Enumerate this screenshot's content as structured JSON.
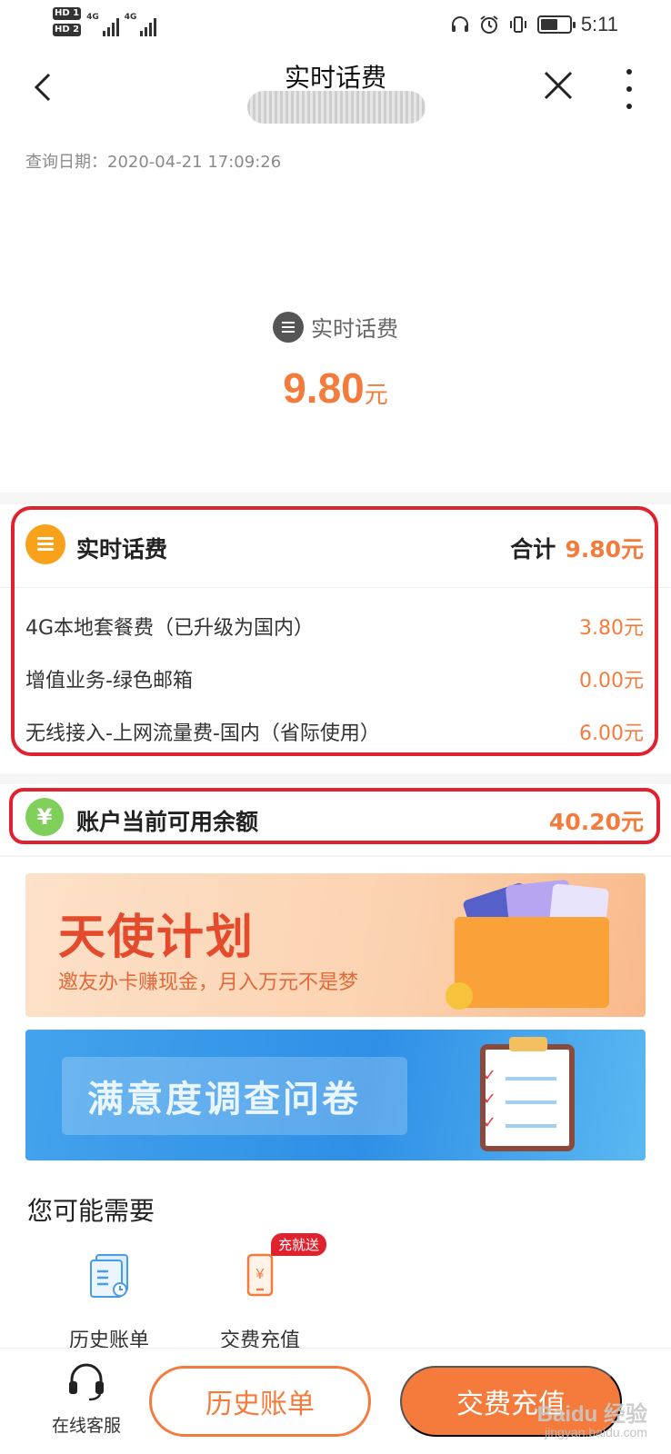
{
  "status_bar": {
    "sim1": "HD 1",
    "sim2": "HD 2",
    "network1": "4G",
    "network2": "4G",
    "time": "5:11",
    "battery_level": 0.6,
    "icons": [
      "headset-icon",
      "alarm-icon",
      "vibrate-icon",
      "battery-icon"
    ]
  },
  "nav": {
    "title": "实时话费",
    "icons": [
      "back-icon",
      "close-icon",
      "more-icon"
    ]
  },
  "summary": {
    "query_date": "查询日期：2020-04-21 17:09:26",
    "label": "实时话费",
    "amount": "9.80",
    "unit": "元"
  },
  "charges": {
    "title": "实时话费",
    "total_label": "合计",
    "total_value": "9.80元",
    "items": [
      {
        "name": "4G本地套餐费（已升级为国内）",
        "value": "3.80元"
      },
      {
        "name": "增值业务-绿色邮箱",
        "value": "0.00元"
      },
      {
        "name": "无线接入-上网流量费-国内（省际使用）",
        "value": "6.00元"
      }
    ]
  },
  "balance": {
    "icon_glyph": "¥",
    "label": "账户当前可用余额",
    "value": "40.20元"
  },
  "banners": {
    "angel_title": "天使计划",
    "angel_subtitle": "邀友办卡赚现金，月入万元不是梦",
    "survey_title": "满意度调查问卷"
  },
  "needs": {
    "title": "您可能需要",
    "items": [
      {
        "label": "历史账单",
        "icon": "bill-history-icon"
      },
      {
        "label": "交费充值",
        "icon": "recharge-icon",
        "badge": "充就送"
      }
    ]
  },
  "bottom": {
    "service_label": "在线客服",
    "history_button": "历史账单",
    "pay_button": "交费充值",
    "watermark": "Baidu 经验",
    "watermark_url": "jingyan.baidu.com"
  },
  "colors": {
    "accent": "#f47b3b",
    "highlight_border": "#e0222e",
    "charge_icon": "#f8a21c",
    "balance_icon": "#7fd05a"
  }
}
